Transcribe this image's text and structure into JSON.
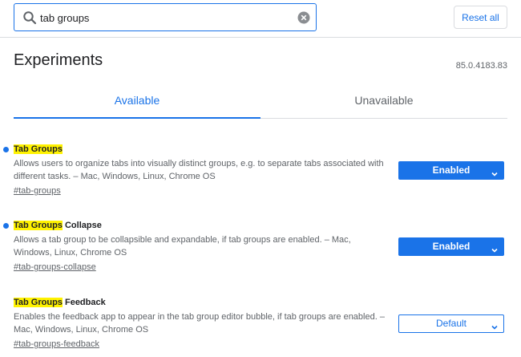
{
  "search": {
    "value": "tab groups",
    "placeholder": "Search flags"
  },
  "header": {
    "reset_label": "Reset all",
    "title": "Experiments",
    "version": "85.0.4183.83"
  },
  "tabs": [
    {
      "label": "Available",
      "active": true
    },
    {
      "label": "Unavailable",
      "active": false
    }
  ],
  "experiments": [
    {
      "name_highlight": "Tab Groups",
      "name_rest": "",
      "description": "Allows users to organize tabs into visually distinct groups, e.g. to separate tabs associated with different tasks. – Mac, Windows, Linux, Chrome OS",
      "link": "#tab-groups",
      "value": "Enabled",
      "modified": true
    },
    {
      "name_highlight": "Tab Groups",
      "name_rest": " Collapse",
      "description": "Allows a tab group to be collapsible and expandable, if tab groups are enabled. – Mac, Windows, Linux, Chrome OS",
      "link": "#tab-groups-collapse",
      "value": "Enabled",
      "modified": true
    },
    {
      "name_highlight": "Tab Groups",
      "name_rest": " Feedback",
      "description": "Enables the feedback app to appear in the tab group editor bubble, if tab groups are enabled. – Mac, Windows, Linux, Chrome OS",
      "link": "#tab-groups-feedback",
      "value": "Default",
      "modified": false
    }
  ],
  "colors": {
    "accent": "#1a73e8",
    "highlight": "#fff200",
    "text_secondary": "#5f6368"
  }
}
